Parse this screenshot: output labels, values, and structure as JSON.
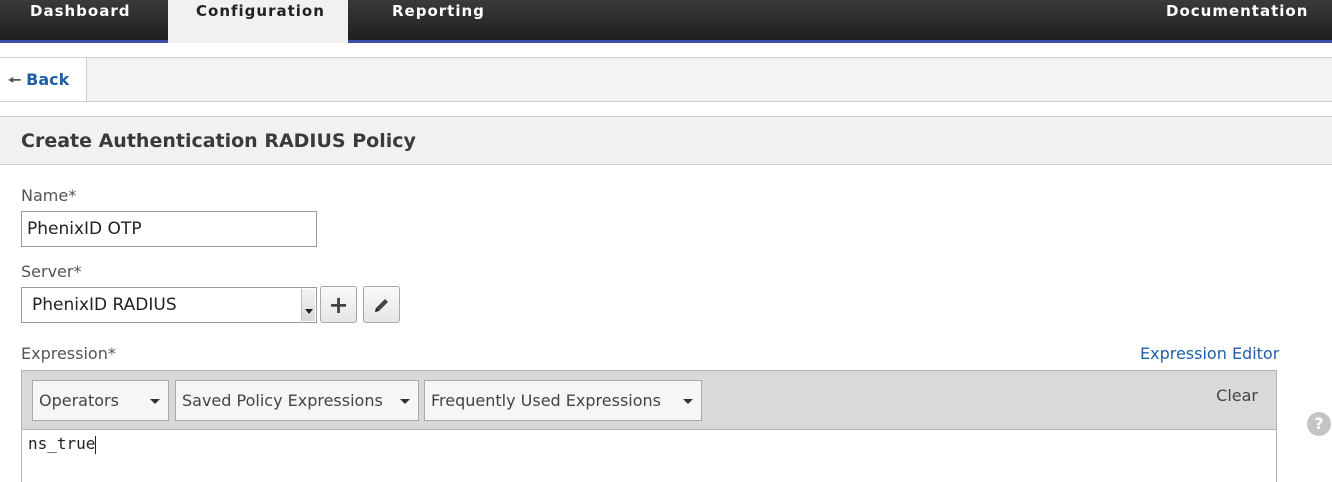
{
  "nav": {
    "tabs": [
      {
        "label": "Dashboard"
      },
      {
        "label": "Configuration"
      },
      {
        "label": "Reporting"
      },
      {
        "label": "Documentation"
      }
    ],
    "active_tab": "Configuration",
    "accent_color": "#3b4fa8"
  },
  "back": {
    "label": "Back",
    "icon": "arrow-left-icon"
  },
  "panel": {
    "title": "Create Authentication RADIUS Policy"
  },
  "form": {
    "name_label": "Name*",
    "name_value": "PhenixID OTP",
    "server_label": "Server*",
    "server_value": "PhenixID RADIUS",
    "add_icon": "plus-icon",
    "edit_icon": "pencil-icon",
    "expression_label": "Expression*",
    "expression_editor_link": "Expression Editor",
    "operators_label": "Operators",
    "saved_label": "Saved Policy Expressions",
    "frequent_label": "Frequently Used Expressions",
    "clear_label": "Clear",
    "expression_value": "ns_true"
  },
  "help": {
    "icon": "help-icon",
    "glyph": "?"
  }
}
